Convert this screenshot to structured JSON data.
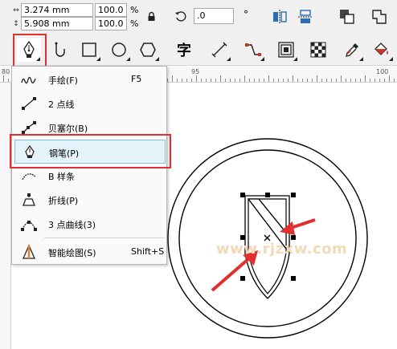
{
  "property_bar": {
    "width_value": "3.274 mm",
    "height_value": "5.908 mm",
    "scale_x": "100.0",
    "scale_y": "100.0",
    "percent_symbol": "%",
    "rotation_value": ".0",
    "degree_symbol": "°"
  },
  "ruler": {
    "labels": [
      "80",
      "95",
      "100"
    ]
  },
  "flyout_menu": {
    "items": [
      {
        "label": "手绘(F)",
        "shortcut": "F5",
        "icon": "freehand-icon"
      },
      {
        "label": "2 点线",
        "shortcut": "",
        "icon": "two-point-line-icon"
      },
      {
        "label": "贝塞尔(B)",
        "shortcut": "",
        "icon": "bezier-icon"
      },
      {
        "label": "钢笔(P)",
        "shortcut": "",
        "icon": "pen-icon",
        "highlighted": true
      },
      {
        "label": "B 样条",
        "shortcut": "",
        "icon": "b-spline-icon"
      },
      {
        "label": "折线(P)",
        "shortcut": "",
        "icon": "polyline-icon"
      },
      {
        "label": "3 点曲线(3)",
        "shortcut": "",
        "icon": "three-point-curve-icon"
      },
      {
        "label": "智能绘图(S)",
        "shortcut": "Shift+S",
        "icon": "smart-drawing-icon"
      }
    ]
  },
  "toolbox": {
    "text_tool_glyph": "字"
  },
  "watermark": "www.rjzxw.com",
  "colors": {
    "highlight_bg": "#e5f3fb",
    "highlight_border": "#86c0e3",
    "annotation_red": "#e03030",
    "toolbar_bg": "#f0f0f0"
  }
}
